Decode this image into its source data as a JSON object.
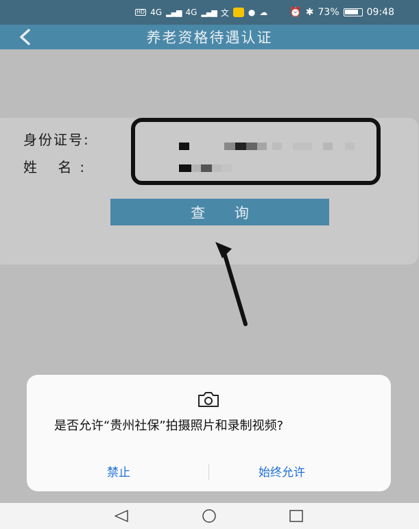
{
  "status_bar": {
    "network_1": "4G",
    "network_2": "4G",
    "battery_text": "73%",
    "battery_level": 0.73,
    "time": "09:48",
    "icons": [
      "hd-icon",
      "signal-icon",
      "signal-icon",
      "translate-icon",
      "app-notification-icon",
      "chat-icon",
      "cloud-icon",
      "alarm-icon",
      "bluetooth-icon",
      "battery-icon"
    ]
  },
  "header": {
    "title": "养老资格待遇认证"
  },
  "form": {
    "id_label": "身份证号:",
    "name_label": "姓 名:",
    "query_button": "查 询"
  },
  "dialog": {
    "icon": "camera-icon",
    "message": "是否允许“贵州社保”拍摄照片和录制视频?",
    "deny_label": "禁止",
    "allow_label": "始终允许"
  },
  "colors": {
    "header": "#4a88a8",
    "status": "#41697f",
    "accent_link": "#1e6fd9",
    "background": "#bcbcbc"
  }
}
